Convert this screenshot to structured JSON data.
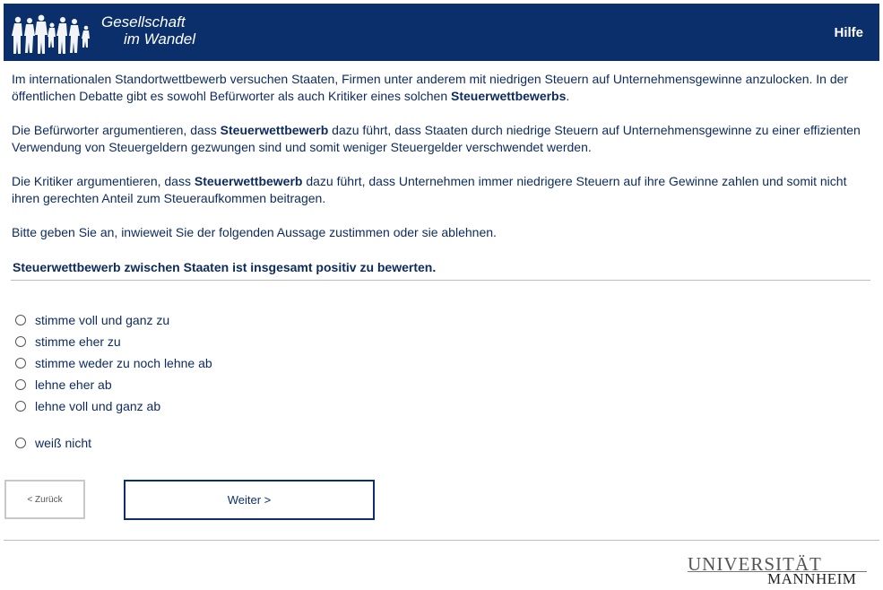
{
  "header": {
    "logo_line1": "Gesellschaft",
    "logo_line2": "im Wandel",
    "help_label": "Hilfe",
    "colors": {
      "bar": "#0b2f6b",
      "text": "#ffffff"
    }
  },
  "intro": {
    "p1_pre": "Im internationalen Standortwettbewerb versuchen Staaten, Firmen unter anderem mit niedrigen Steuern auf Unternehmensgewinne anzulocken. In der öffentlichen Debatte gibt es sowohl Befürworter als auch Kritiker eines solchen ",
    "p1_bold": "Steuerwettbewerbs",
    "p1_post": ".",
    "p2_pre": "Die Befürworter argumentieren, dass ",
    "p2_bold": "Steuerwettbewerb",
    "p2_post": " dazu führt, dass Staaten durch niedrige Steuern auf Unternehmensgewinne zu einer effizienten Verwendung von Steuergeldern gezwungen sind und somit weniger Steuergelder verschwendet werden.",
    "p3_pre": "Die Kritiker argumentieren, dass ",
    "p3_bold": "Steuerwettbewerb",
    "p3_post": " dazu führt, dass Unternehmen immer niedrigere Steuern auf ihre Gewinne zahlen und somit nicht ihren gerechten Anteil zum Steueraufkommen beitragen.",
    "p4": "Bitte geben Sie an, inwieweit Sie der folgenden Aussage zustimmen oder sie ablehnen."
  },
  "question": "Steuerwettbewerb zwischen Staaten ist insgesamt positiv zu bewerten.",
  "options": [
    "stimme voll und ganz zu",
    "stimme eher zu",
    "stimme weder zu noch lehne ab",
    "lehne eher ab",
    "lehne voll und ganz ab",
    "weiß nicht"
  ],
  "nav": {
    "back_label": "< Zurück",
    "next_label": "Weiter >"
  },
  "footer": {
    "uni_line1": "UNIVERSITÄT",
    "uni_line2": "MANNHEIM"
  }
}
